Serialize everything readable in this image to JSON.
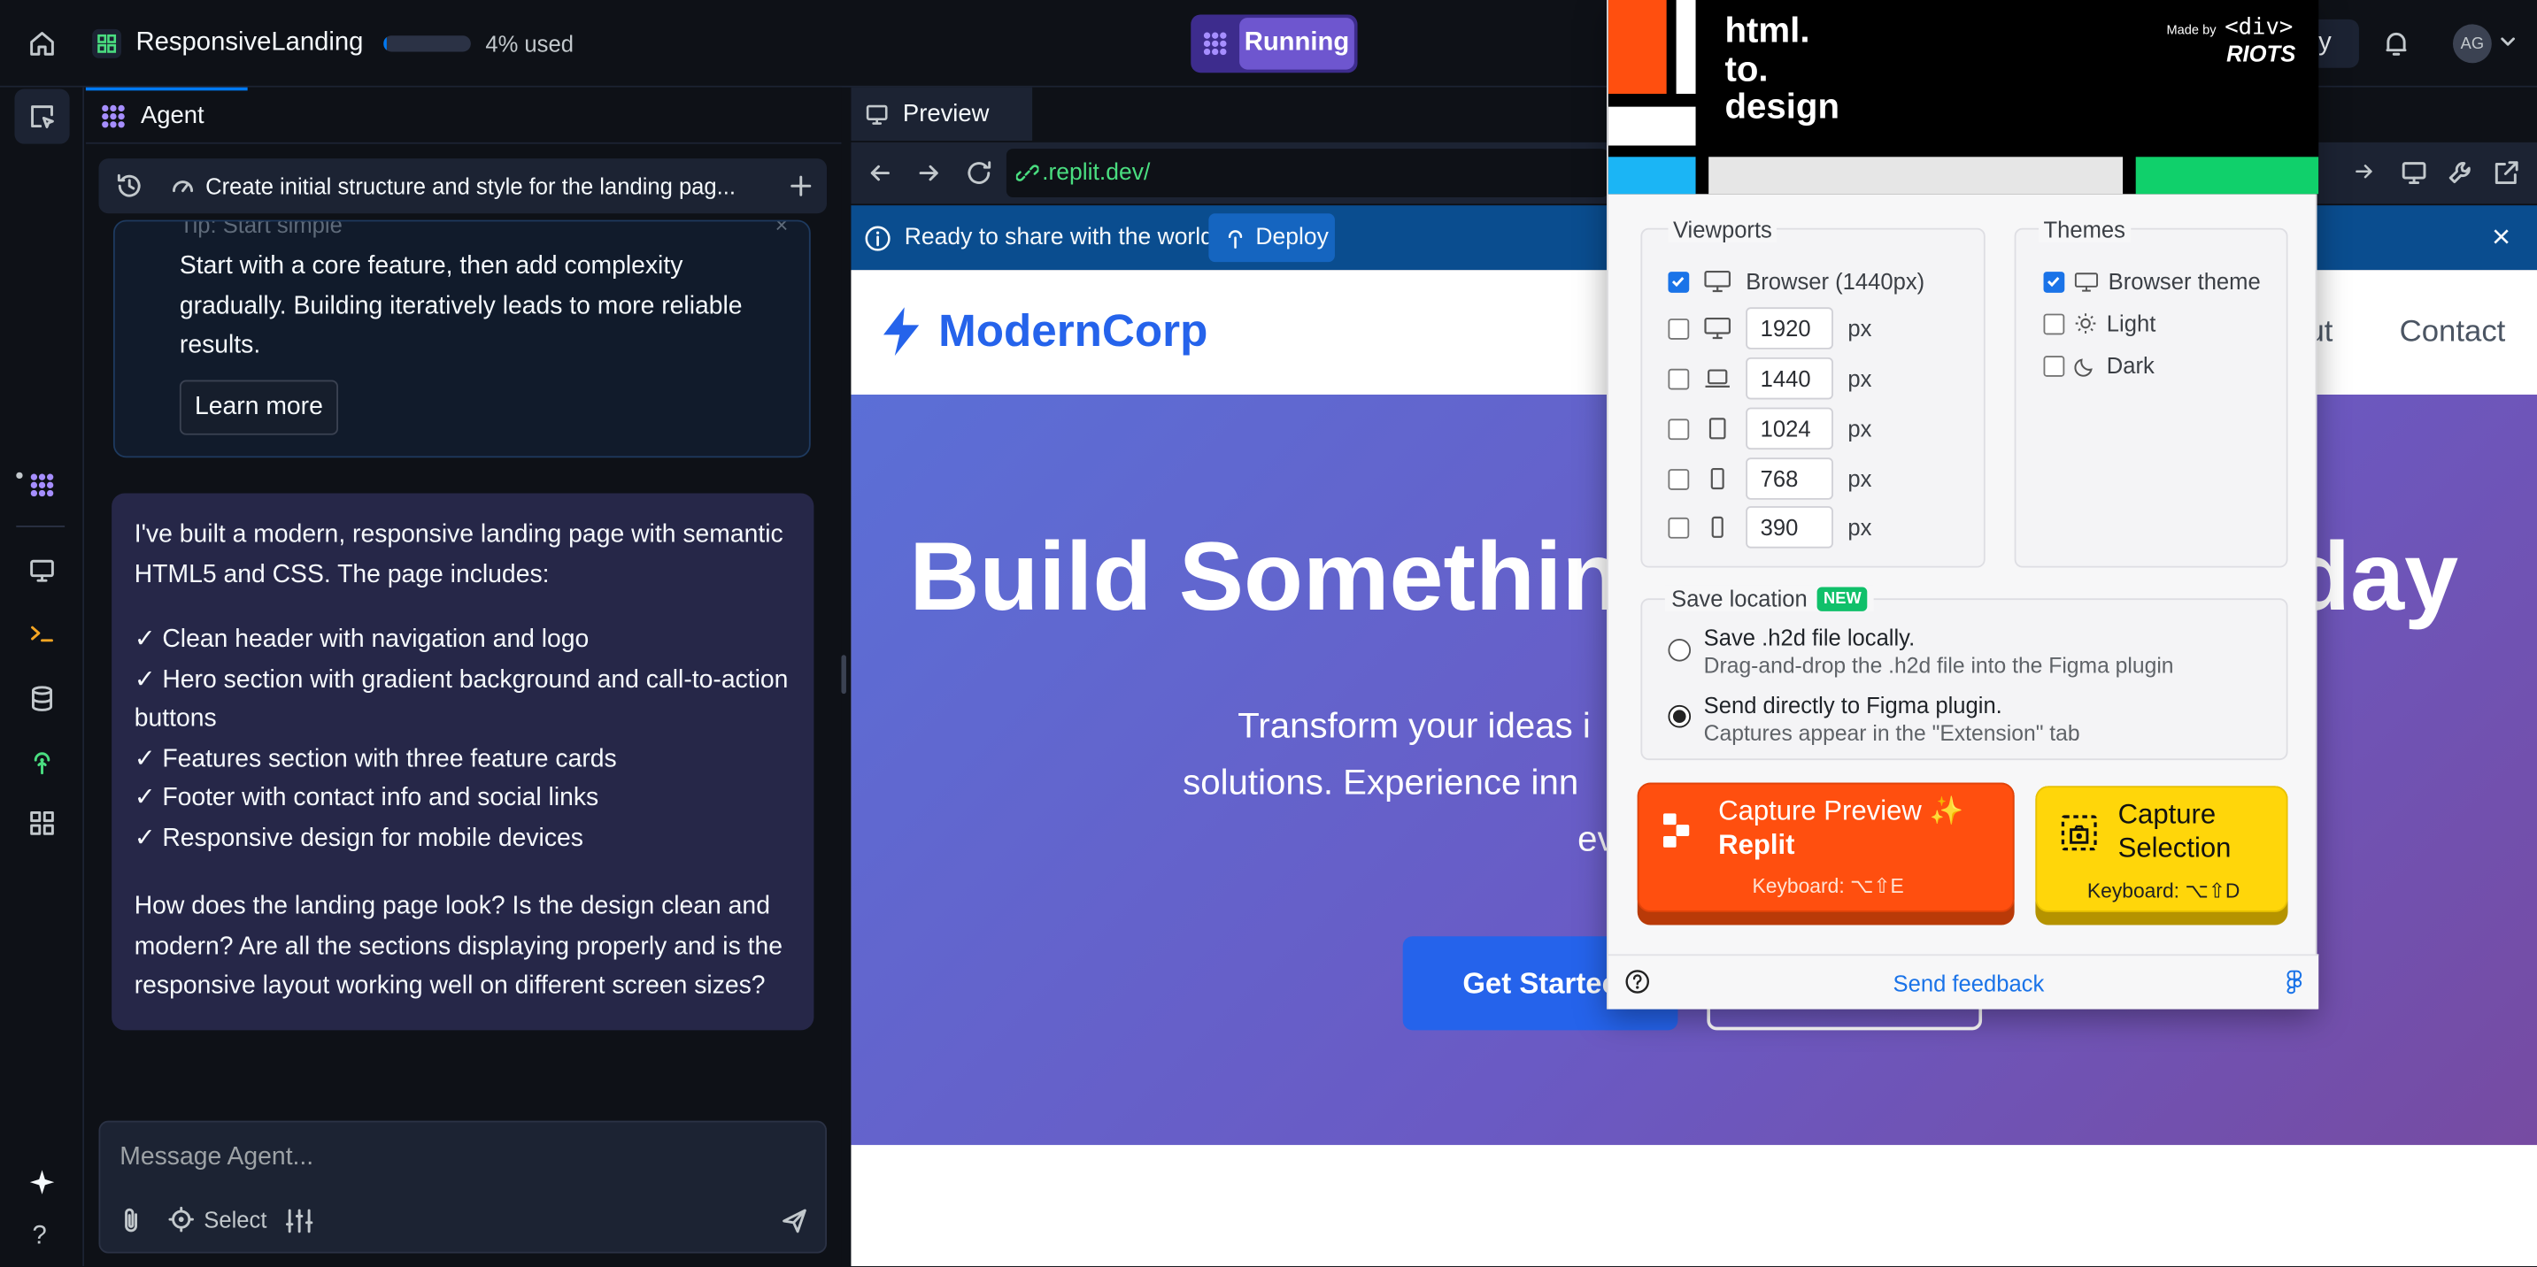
{
  "topbar": {
    "project_name": "ResponsiveLanding",
    "usage_label": "4% used",
    "usage_fraction": 0.04,
    "run_status": "Running",
    "deploy_partial": "oy",
    "avatar_initials": "AG"
  },
  "agent": {
    "tab_label": "Agent",
    "thread_title": "Create initial structure and style for the landing pag...",
    "tip": {
      "heading": "Tip: Start simple",
      "body": "Start with a core feature, then add complexity gradually. Building iteratively leads to more reliable results.",
      "button": "Learn more"
    },
    "message": {
      "intro": "I've built a modern, responsive landing page with semantic HTML5 and CSS. The page includes:",
      "items": [
        "✓ Clean header with navigation and logo",
        "✓ Hero section with gradient background and call-to-action buttons",
        "✓ Features section with three feature cards",
        "✓ Footer with contact info and social links",
        "✓ Responsive design for mobile devices"
      ],
      "question": "How does the landing page look? Is the design clean and modern? Are all the sections displaying properly and is the responsive layout working well on different screen sizes?"
    },
    "input_placeholder": "Message Agent...",
    "select_label": "Select"
  },
  "preview": {
    "tab_label": "Preview",
    "url": ".replit.dev/",
    "banner_text": "Ready to share with the world?",
    "banner_button": "Deploy",
    "site": {
      "brand": "ModernCorp",
      "nav_partial": "ut",
      "nav_contact": "Contact",
      "hero_title_left": "Build Somethin",
      "hero_title_right": "day",
      "hero_sub_1": "Transform your ideas i",
      "hero_sub_2": "solutions. Experience inn",
      "hero_sub_3": "ev",
      "cta_primary": "Get Startec"
    }
  },
  "plugin": {
    "logo_line1": "html.",
    "logo_line2": "to.",
    "logo_line3": "design",
    "made_by": "Made by",
    "made_by_brand1": "<div>",
    "made_by_brand2": "RIOTS",
    "viewports_title": "Viewports",
    "viewport_browser": "Browser (1440px)",
    "viewport_sizes": [
      "1920",
      "1440",
      "1024",
      "768",
      "390"
    ],
    "px_unit": "px",
    "themes_title": "Themes",
    "theme_browser": "Browser theme",
    "theme_light": "Light",
    "theme_dark": "Dark",
    "save_title": "Save location",
    "new_badge": "NEW",
    "save_local_title": "Save .h2d file locally.",
    "save_local_desc": "Drag-and-drop the .h2d file into the Figma plugin",
    "save_figma_title": "Send directly to Figma plugin.",
    "save_figma_desc": "Captures appear in the \"Extension\" tab",
    "capture_preview_l1": "Capture Preview ✨",
    "capture_preview_l2": "Replit",
    "capture_preview_kbd": "Keyboard: ⌥⇧E",
    "capture_selection_l1": "Capture",
    "capture_selection_l2": "Selection",
    "capture_selection_kbd": "Keyboard: ⌥⇧D",
    "feedback": "Send feedback"
  },
  "colors": {
    "accent_purple": "#6e56cf",
    "replit_orange": "#f26207",
    "capture_orange": "#ff4f0f",
    "capture_yellow": "#ffd60a",
    "brand_blue": "#2563eb",
    "banner_blue": "#0a4d8f"
  }
}
